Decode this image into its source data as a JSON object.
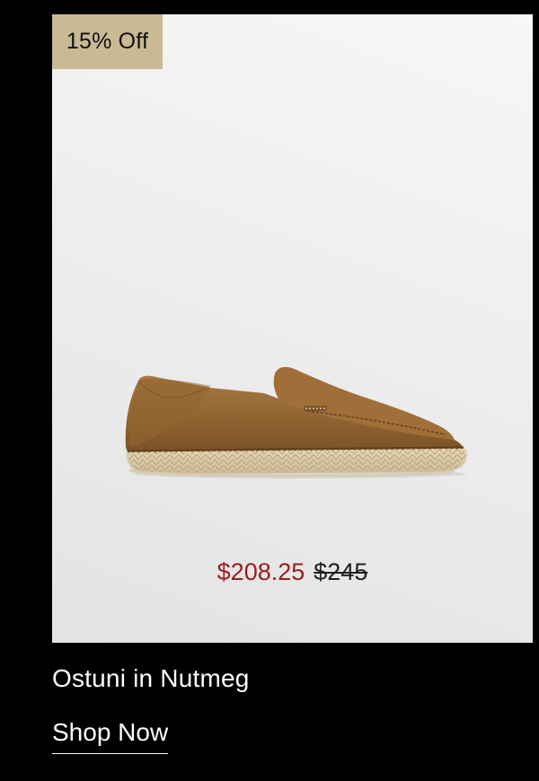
{
  "product": {
    "discount_badge": "15% Off",
    "name": "Ostuni in Nutmeg",
    "sale_price": "$208.25",
    "original_price": "$245",
    "image_icon": "espadrille-loafer-image"
  },
  "cta": {
    "label": "Shop Now"
  },
  "colors": {
    "background": "#000000",
    "badge": "#c9b995",
    "sale_price": "#9c1c1c",
    "shoe_suede": "#9a6a34"
  }
}
